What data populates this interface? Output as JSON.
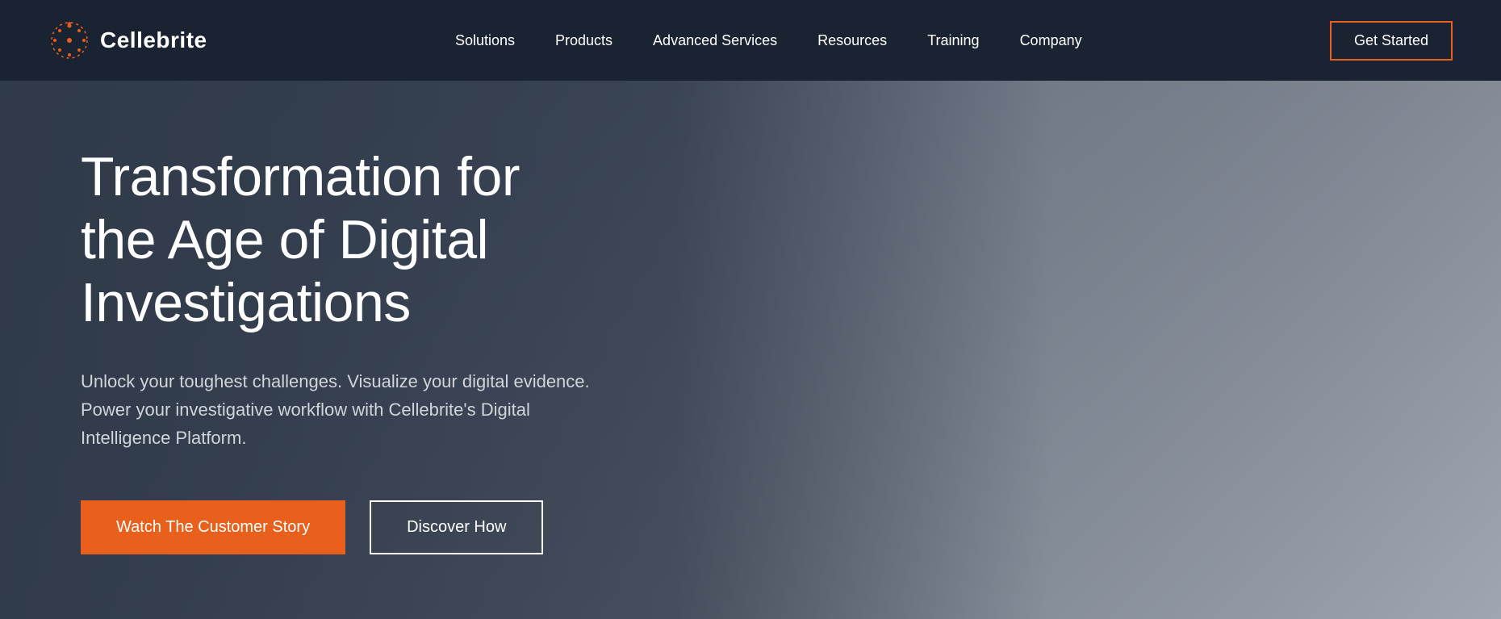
{
  "brand": {
    "name": "Cellebrite"
  },
  "navbar": {
    "items": [
      {
        "label": "Solutions",
        "id": "solutions"
      },
      {
        "label": "Products",
        "id": "products"
      },
      {
        "label": "Advanced Services",
        "id": "advanced-services"
      },
      {
        "label": "Resources",
        "id": "resources"
      },
      {
        "label": "Training",
        "id": "training"
      },
      {
        "label": "Company",
        "id": "company"
      }
    ],
    "cta_label": "Get Started"
  },
  "hero": {
    "title": "Transformation for the Age of Digital Investigations",
    "subtitle": "Unlock your toughest challenges. Visualize your digital evidence. Power your investigative workflow with Cellebrite's Digital Intelligence Platform.",
    "button_primary": "Watch The Customer Story",
    "button_secondary": "Discover How"
  },
  "colors": {
    "navbar_bg": "#1a2332",
    "accent_orange": "#e8601c",
    "hero_bg_start": "#3d4a58",
    "hero_bg_end": "#9ca3af",
    "text_white": "#ffffff",
    "text_light": "#d1d5db"
  }
}
